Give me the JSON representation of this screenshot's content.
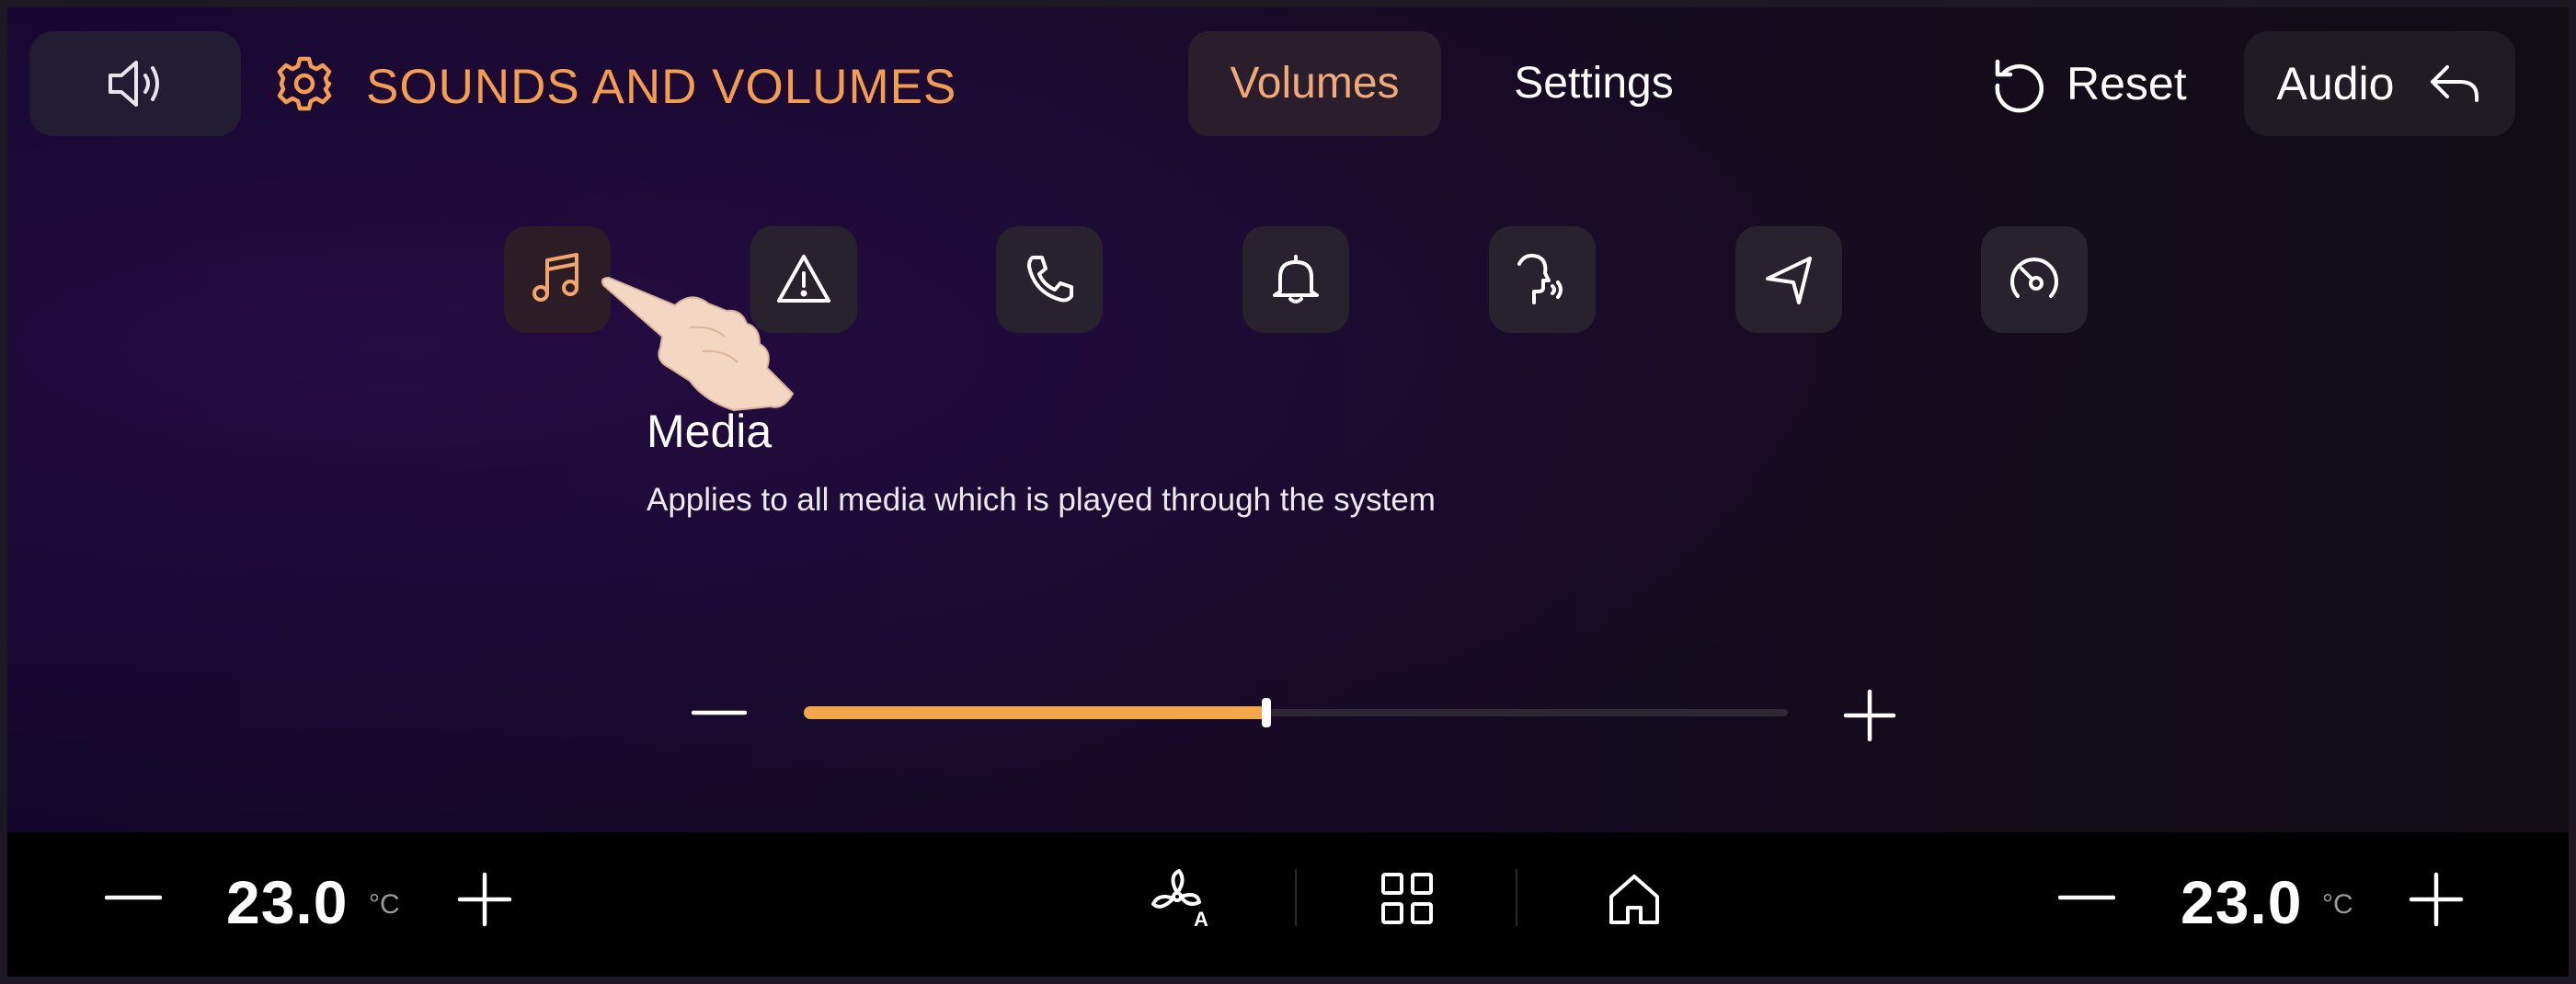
{
  "header": {
    "sound_icon": "speaker-icon",
    "settings_icon": "gear-icon",
    "title": "SOUNDS AND VOLUMES",
    "tabs": [
      {
        "label": "Volumes",
        "selected": true
      },
      {
        "label": "Settings",
        "selected": false
      }
    ],
    "reset_label": "Reset",
    "reset_icon": "reset-icon",
    "audio_label": "Audio",
    "back_icon": "back-arrow-icon"
  },
  "categories": [
    {
      "icon": "music-note-icon",
      "selected": true
    },
    {
      "icon": "warning-triangle-icon",
      "selected": false
    },
    {
      "icon": "phone-icon",
      "selected": false
    },
    {
      "icon": "bell-icon",
      "selected": false
    },
    {
      "icon": "voice-assistant-icon",
      "selected": false
    },
    {
      "icon": "navigation-arrow-icon",
      "selected": false
    },
    {
      "icon": "speedometer-icon",
      "selected": false
    }
  ],
  "selected_category": {
    "title": "Media",
    "description": "Applies to all media which is played through the system"
  },
  "volume": {
    "level": 0.47,
    "minus_icon": "minus-icon",
    "plus_icon": "plus-icon"
  },
  "climate": {
    "left_temp": "23.0",
    "right_temp": "23.0",
    "unit": "°C"
  },
  "bottom_nav": {
    "icons": [
      "fan-auto-icon",
      "apps-grid-icon",
      "home-icon"
    ]
  },
  "colors": {
    "accent": "#f29d52",
    "slider_fill": "#f4a64a",
    "background": "#12072a"
  }
}
